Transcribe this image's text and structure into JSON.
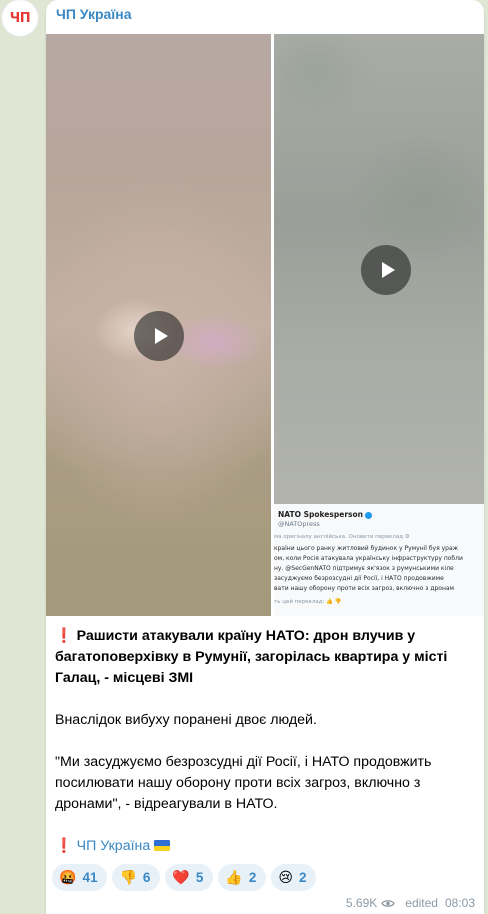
{
  "channel": {
    "avatar_text": "ЧП",
    "name": "ЧП Україна"
  },
  "media": {
    "tweet": {
      "author": "NATO Spokesperson",
      "handle": "@NATOpress",
      "translated_note": "ма оригіналу англійська. Оновити переклад ⚙",
      "lines": [
        "країни цього ранку житловий будинок у Румунії буя ураж",
        "ом, коли Росія атакувала українську інфраструктуру побли",
        "ну. @SecGenNATO підтримує як'язок з румунськими кіле",
        "засуджуємо безрозсудні дії Росії, і НАТО продовжиме",
        "вати нашу оборону проти всіх загроз, включно з дронам"
      ],
      "rate_note": "ть цей переклад:  👍  👎"
    }
  },
  "post": {
    "headline_mark": "❗",
    "headline": "Рашисти атакували країну НАТО: дрон влучив у багатоповерхівку в Румунії, загорілась квартира у місті Галац, - місцеві ЗМІ",
    "para1": "Внаслідок вибуху поранені двоє людей.",
    "para2": "\"Ми засуджуємо безрозсудні дії Росії, і НАТО продовжить посилювати нашу оборону проти всіх загроз, включно з дронами\", - відреагували в НАТО.",
    "signature_mark": "❗",
    "signature_link": "ЧП Україна"
  },
  "reactions": [
    {
      "icon": "angry-face-icon",
      "emoji": "🤬",
      "count": "41"
    },
    {
      "icon": "thumbs-down-icon",
      "emoji": "👎",
      "count": "6"
    },
    {
      "icon": "red-heart-icon",
      "emoji": "❤️",
      "count": "5"
    },
    {
      "icon": "thumbs-up-icon",
      "emoji": "👍",
      "count": "2"
    },
    {
      "icon": "crying-face-icon",
      "emoji": "😢",
      "count": "2"
    }
  ],
  "meta": {
    "views": "5.69K",
    "edited_label": "edited",
    "time": "08:03"
  },
  "colors": {
    "accent": "#3a88c4",
    "background": "#dfe7d4",
    "alert_red": "#e53935",
    "reaction_bg": "#e8f1f8"
  }
}
